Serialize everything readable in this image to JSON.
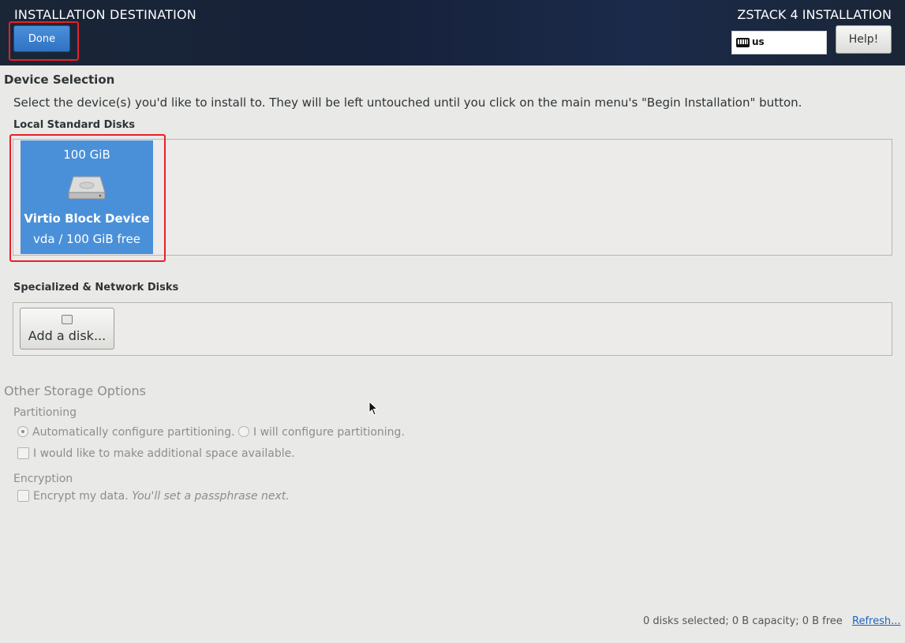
{
  "header": {
    "title": "INSTALLATION DESTINATION",
    "done_label": "Done",
    "product_title": "ZSTACK 4 INSTALLATION",
    "keyboard_layout": "us",
    "help_label": "Help!"
  },
  "device_selection": {
    "heading": "Device Selection",
    "instruction": "Select the device(s) you'd like to install to.  They will be left untouched until you click on the main menu's \"Begin Installation\" button.",
    "local_disks_heading": "Local Standard Disks",
    "disks": [
      {
        "capacity": "100 GiB",
        "name": "Virtio Block Device",
        "detail": "vda  /  100 GiB free",
        "selected": true,
        "icon": "hard-disk-icon"
      }
    ],
    "specialized_heading": "Specialized & Network Disks",
    "add_disk_label": "Add a disk..."
  },
  "storage_options": {
    "heading": "Other Storage Options",
    "partitioning_heading": "Partitioning",
    "auto_partitioning_label": "Automatically configure partitioning.",
    "manual_partitioning_label": "I will configure partitioning.",
    "additional_space_label": "I would like to make additional space available.",
    "encryption_heading": "Encryption",
    "encrypt_label": "Encrypt my data.",
    "encrypt_note": "You'll set a passphrase next."
  },
  "footer": {
    "summary": "0 disks selected; 0 B capacity; 0 B free",
    "refresh_label": "Refresh..."
  },
  "colors": {
    "header_bg": "#1a2636",
    "accent_blue": "#4a90d9",
    "annotation_red": "#e8202a",
    "page_bg": "#e9e9e7"
  }
}
